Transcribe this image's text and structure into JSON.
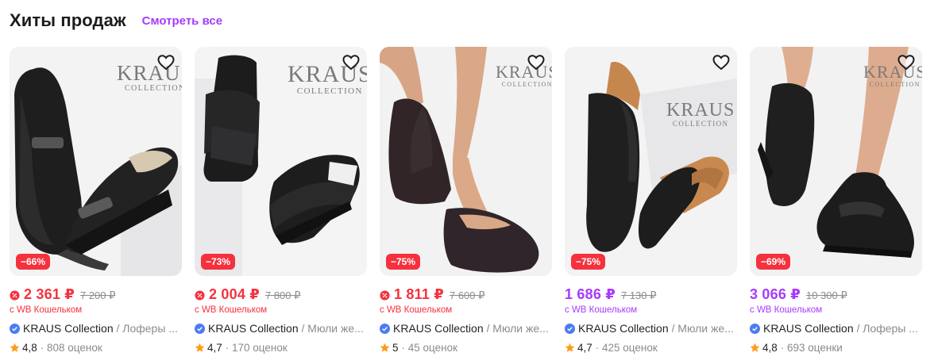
{
  "header": {
    "title": "Хиты продаж",
    "see_all": "Смотреть все"
  },
  "colors": {
    "accent": "#a73afd",
    "sale": "#f5313d",
    "rating_star": "#ff9c1a",
    "verified": "#4b7cf3"
  },
  "logo": {
    "big": "KRAUS",
    "small": "COLLECTION"
  },
  "products": [
    {
      "discount": "−66%",
      "price": "2 361 ₽",
      "old_price": "7 200 ₽",
      "wallet": "с WB Кошельком",
      "brand": "KRAUS Collection",
      "name": "/ Лоферы ...",
      "rating": "4,8",
      "reviews": "· 808 оценок",
      "price_style": "sale"
    },
    {
      "discount": "−73%",
      "price": "2 004 ₽",
      "old_price": "7 800 ₽",
      "wallet": "с WB Кошельком",
      "brand": "KRAUS Collection",
      "name": "/ Мюли же...",
      "rating": "4,7",
      "reviews": "· 170 оценок",
      "price_style": "sale"
    },
    {
      "discount": "−75%",
      "price": "1 811 ₽",
      "old_price": "7 600 ₽",
      "wallet": "с WB Кошельком",
      "brand": "KRAUS Collection",
      "name": "/ Мюли же...",
      "rating": "5",
      "reviews": "· 45 оценок",
      "price_style": "sale"
    },
    {
      "discount": "−75%",
      "price": "1 686 ₽",
      "old_price": "7 130 ₽",
      "wallet": "с WB Кошельком",
      "brand": "KRAUS Collection",
      "name": "/ Мюли же...",
      "rating": "4,7",
      "reviews": "· 425 оценок",
      "price_style": "wallet"
    },
    {
      "discount": "−69%",
      "price": "3 066 ₽",
      "old_price": "10 300 ₽",
      "wallet": "с WB Кошельком",
      "brand": "KRAUS Collection",
      "name": "/ Лоферы ...",
      "rating": "4,8",
      "reviews": "· 693 оценки",
      "price_style": "wallet"
    }
  ]
}
